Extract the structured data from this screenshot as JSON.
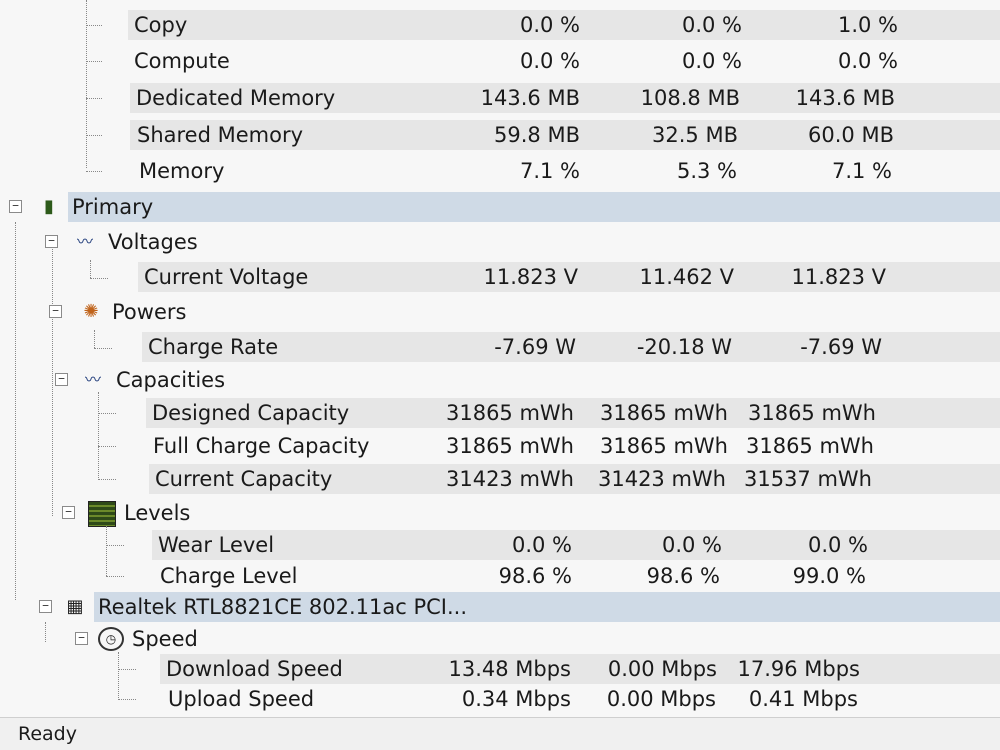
{
  "rows": {
    "copy": {
      "label": "Copy",
      "v1": "0.0 %",
      "v2": "0.0 %",
      "v3": "1.0 %"
    },
    "compute": {
      "label": "Compute",
      "v1": "0.0 %",
      "v2": "0.0 %",
      "v3": "0.0 %"
    },
    "dedicated_memory": {
      "label": "Dedicated Memory",
      "v1": "143.6 MB",
      "v2": "108.8 MB",
      "v3": "143.6 MB"
    },
    "shared_memory": {
      "label": "Shared Memory",
      "v1": "59.8 MB",
      "v2": "32.5 MB",
      "v3": "60.0 MB"
    },
    "memory": {
      "label": "Memory",
      "v1": "7.1 %",
      "v2": "5.3 %",
      "v3": "7.1 %"
    },
    "primary": {
      "label": "Primary"
    },
    "voltages": {
      "label": "Voltages"
    },
    "current_voltage": {
      "label": "Current Voltage",
      "v1": "11.823 V",
      "v2": "11.462 V",
      "v3": "11.823 V"
    },
    "powers": {
      "label": "Powers"
    },
    "charge_rate": {
      "label": "Charge Rate",
      "v1": "-7.69 W",
      "v2": "-20.18 W",
      "v3": "-7.69 W"
    },
    "capacities": {
      "label": "Capacities"
    },
    "designed_capacity": {
      "label": "Designed Capacity",
      "v1": "31865 mWh",
      "v2": "31865 mWh",
      "v3": "31865 mWh"
    },
    "full_charge_capacity": {
      "label": "Full Charge Capacity",
      "v1": "31865 mWh",
      "v2": "31865 mWh",
      "v3": "31865 mWh"
    },
    "current_capacity": {
      "label": "Current Capacity",
      "v1": "31423 mWh",
      "v2": "31423 mWh",
      "v3": "31537 mWh"
    },
    "levels": {
      "label": "Levels"
    },
    "wear_level": {
      "label": "Wear Level",
      "v1": "0.0 %",
      "v2": "0.0 %",
      "v3": "0.0 %"
    },
    "charge_level": {
      "label": "Charge Level",
      "v1": "98.6 %",
      "v2": "98.6 %",
      "v3": "99.0 %"
    },
    "realtek": {
      "label": "Realtek RTL8821CE 802.11ac PCI..."
    },
    "speed": {
      "label": "Speed"
    },
    "download_speed": {
      "label": "Download Speed",
      "v1": "13.48 Mbps",
      "v2": "0.00 Mbps",
      "v3": "17.96 Mbps"
    },
    "upload_speed": {
      "label": "Upload Speed",
      "v1": "0.34 Mbps",
      "v2": "0.00 Mbps",
      "v3": "0.41 Mbps"
    }
  },
  "status": {
    "text": "Ready"
  },
  "icons": {
    "battery": "battery-icon",
    "voltage": "voltage-graph-icon",
    "power": "power-icon",
    "capacity": "capacity-graph-icon",
    "levels": "levels-bar-icon",
    "network": "network-card-icon",
    "speed": "speed-clock-icon"
  }
}
